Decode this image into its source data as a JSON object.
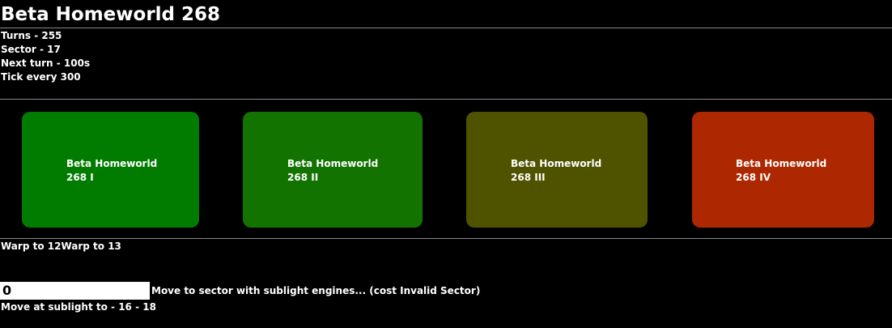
{
  "header": {
    "title": "Beta Homeworld 268"
  },
  "stats": {
    "turns": "Turns - 255",
    "sector": "Sector - 17",
    "next_turn": "Next turn - 100s",
    "tick": "Tick every 300"
  },
  "planets": [
    {
      "line1": "Beta Homeworld",
      "line2": "268 I",
      "color": "#017c01"
    },
    {
      "line1": "Beta Homeworld",
      "line2": "268 II",
      "color": "#137301"
    },
    {
      "line1": "Beta Homeworld",
      "line2": "268 III",
      "color": "#4f5300"
    },
    {
      "line1": "Beta Homeworld",
      "line2": "268 IV",
      "color": "#ad2800"
    }
  ],
  "warp": {
    "link1": "Warp to 12",
    "link2": "Warp to 13"
  },
  "move": {
    "input_value": "0",
    "label": "Move to sector with sublight engines... (cost Invalid Sector)"
  },
  "sublight": {
    "text": "Move at sublight to - 16 - 18"
  }
}
